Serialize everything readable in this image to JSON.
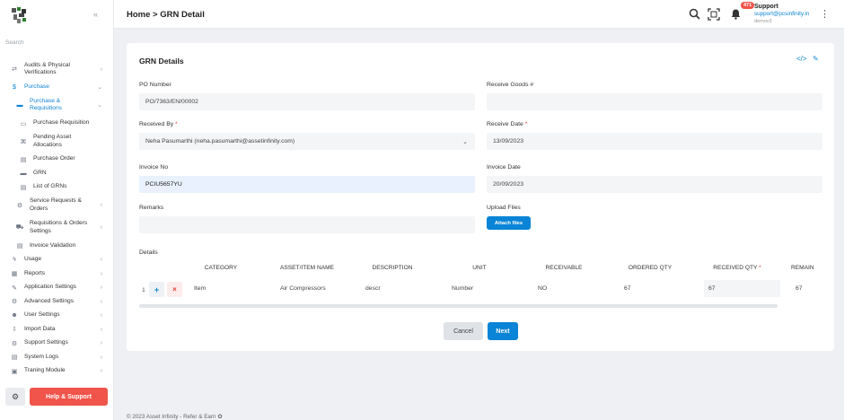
{
  "sidebar": {
    "search_placeholder": "Search",
    "collapse_icon": "chevron-double-left-icon",
    "items": [
      {
        "label": "Audits & Physical Verifications",
        "icon": "audit-icon",
        "chevron": "›"
      },
      {
        "label": "Purchase",
        "icon": "dollar-icon",
        "chevron": "⌄"
      },
      {
        "label": "Purchase & Requisitions",
        "icon": "truck-icon",
        "chevron": "⌄"
      },
      {
        "label": "Purchase Requisition",
        "icon": "laptop-icon"
      },
      {
        "label": "Pending Asset Allocations",
        "icon": "hierarchy-icon"
      },
      {
        "label": "Purchase Order",
        "icon": "document-icon"
      },
      {
        "label": "GRN",
        "icon": "keyboard-icon"
      },
      {
        "label": "List of GRNs",
        "icon": "document-icon"
      },
      {
        "label": "Service Requests & Orders",
        "icon": "cogs-icon",
        "chevron": "›"
      },
      {
        "label": "Requisitions & Orders Settings",
        "icon": "cart-icon",
        "chevron": "›"
      },
      {
        "label": "Invoice Validation",
        "icon": "document-icon"
      },
      {
        "label": "Usage",
        "icon": "bolt-icon",
        "chevron": "›"
      },
      {
        "label": "Reports",
        "icon": "report-icon",
        "chevron": "›"
      },
      {
        "label": "Application Settings",
        "icon": "wrench-icon",
        "chevron": "›"
      },
      {
        "label": "Advanced Settings",
        "icon": "cogs-icon",
        "chevron": "›"
      },
      {
        "label": "User Settings",
        "icon": "users-icon",
        "chevron": "›"
      },
      {
        "label": "Import Data",
        "icon": "import-icon",
        "chevron": "›"
      },
      {
        "label": "Support Settings",
        "icon": "cogs-icon",
        "chevron": "›"
      },
      {
        "label": "System Logs",
        "icon": "log-icon",
        "chevron": "›"
      },
      {
        "label": "Traning Module",
        "icon": "training-icon",
        "chevron": "›"
      }
    ],
    "help_label": "Help & Support"
  },
  "header": {
    "breadcrumb": "Home > GRN Detail",
    "notification_count": "471",
    "user_name": "Support",
    "user_email": "support@pcsinfinity.in",
    "user_sub": "demov3"
  },
  "form": {
    "title": "GRN Details",
    "po_number_label": "PO Number",
    "po_number_value": "PO/7363/EN/00002",
    "receive_goods_label": "Receive Goods #",
    "receive_goods_value": "",
    "received_by_label": "Received By",
    "received_by_value": "Neha Pasumarthi (neha.pasumarthi@assetinfinity.com)",
    "receive_date_label": "Receive Date",
    "receive_date_value": "13/09/2023",
    "invoice_no_label": "Invoice No",
    "invoice_no_value": "PCIU5657YU",
    "invoice_date_label": "Invoice Date",
    "invoice_date_value": "20/09/2023",
    "remarks_label": "Remarks",
    "remarks_value": "",
    "upload_label": "Upload Files",
    "attach_label": "Attach files",
    "required_mark": "*"
  },
  "details": {
    "label": "Details",
    "columns": [
      "CATEGORY",
      "ASSET/ITEM NAME",
      "DESCRIPTION",
      "UNIT",
      "RECEIVABLE",
      "ORDERED QTY",
      "RECEIVED QTY",
      "REMAIN"
    ],
    "row": {
      "index": "1",
      "category": "Item",
      "asset_item_name": "Air Compressors",
      "description": "descr",
      "unit": "Number",
      "receivable": "NO",
      "ordered_qty": "67",
      "received_qty": "67",
      "remaining": "67"
    }
  },
  "buttons": {
    "cancel": "Cancel",
    "next": "Next"
  },
  "footer": {
    "text": "© 2023  Asset Infinity - Refer & Earn"
  }
}
